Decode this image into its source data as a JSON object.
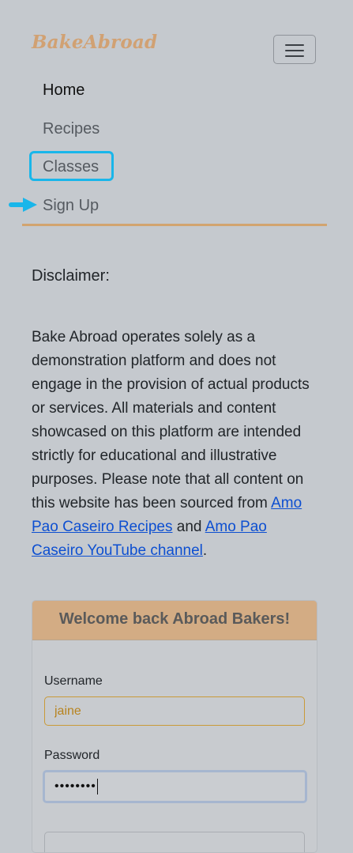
{
  "navbar": {
    "brand": "BakeAbroad",
    "toggler_icon": "hamburger-menu-icon",
    "items": [
      {
        "label": "Home"
      },
      {
        "label": "Recipes"
      },
      {
        "label": "Classes"
      },
      {
        "label": "Sign Up"
      }
    ],
    "arrow_icon": "arrow-right-icon"
  },
  "disclaimer": {
    "title": "Disclaimer:",
    "text_part1": "Bake Abroad operates solely as a demonstration platform and does not engage in the provision of actual products or services. All materials and content showcased on this platform are intended strictly for educational and illustrative purposes. Please note that all content on this website has been sourced from ",
    "link1": "Amo Pao Caseiro Recipes",
    "text_part2": " and ",
    "link2": "Amo Pao Caseiro YouTube channel",
    "text_part3": "."
  },
  "login": {
    "header": "Welcome back Abroad Bakers!",
    "username_label": "Username",
    "username_value": "jaine",
    "password_label": "Password",
    "password_value": "••••••••"
  },
  "colors": {
    "brand": "#d1a173",
    "accent_divider": "#d2a46f",
    "focus_ring": "#19b6ea",
    "link": "#0d4fd1"
  }
}
